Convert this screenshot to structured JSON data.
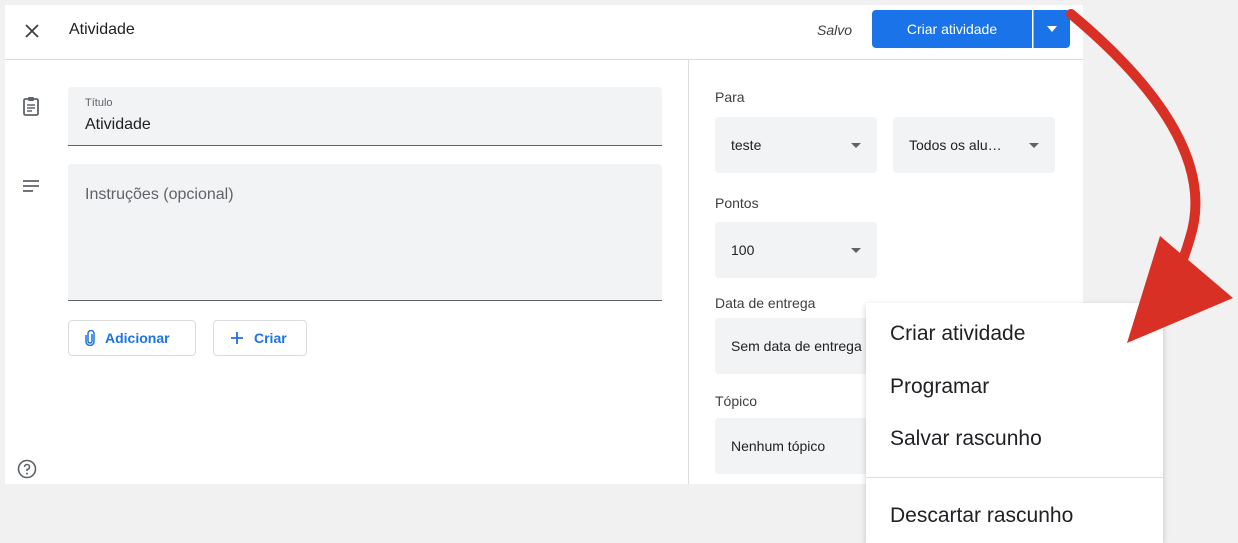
{
  "header": {
    "title": "Atividade",
    "status": "Salvo",
    "primary_button": "Criar atividade"
  },
  "form": {
    "title_label": "Título",
    "title_value": "Atividade",
    "instructions_placeholder": "Instruções (opcional)",
    "add_button": "Adicionar",
    "create_button": "Criar"
  },
  "sidebar": {
    "for_label": "Para",
    "class_value": "teste",
    "students_value": "Todos os alu…",
    "points_label": "Pontos",
    "points_value": "100",
    "due_label": "Data de entrega",
    "due_value": "Sem data de entrega",
    "topic_label": "Tópico",
    "topic_value": "Nenhum tópico"
  },
  "menu": {
    "items": [
      "Criar atividade",
      "Programar",
      "Salvar rascunho",
      "Descartar rascunho"
    ]
  },
  "colors": {
    "accent": "#1a73e8",
    "annotation_arrow": "#d93025",
    "background": "#f1f1f1"
  }
}
